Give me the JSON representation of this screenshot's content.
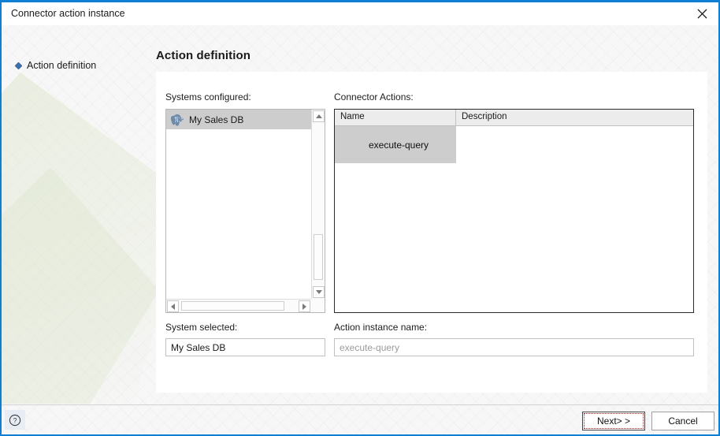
{
  "window": {
    "title": "Connector action instance",
    "close_icon": "close-icon",
    "accent_color": "#0f7fd4"
  },
  "nav": {
    "items": [
      {
        "label": "Action definition",
        "bullet": "diamond-bullet-icon",
        "selected": true
      }
    ]
  },
  "page": {
    "title": "Action definition"
  },
  "systems": {
    "label": "Systems configured:",
    "items": [
      {
        "name": "My Sales DB",
        "icon": "postgresql-icon",
        "selected": true
      }
    ],
    "scrollbars": {
      "vertical_up": "scroll-up-icon",
      "vertical_down": "scroll-down-icon",
      "horizontal_left": "scroll-left-icon",
      "horizontal_right": "scroll-right-icon"
    }
  },
  "actions_table": {
    "label": "Connector Actions:",
    "columns": [
      "Name",
      "Description"
    ],
    "rows": [
      {
        "name": "execute-query",
        "description": "",
        "selected": true
      }
    ]
  },
  "system_selected": {
    "label": "System selected:",
    "value": "My Sales DB",
    "placeholder": ""
  },
  "action_instance_name": {
    "label": "Action instance name:",
    "value": "",
    "placeholder": "execute-query"
  },
  "footer": {
    "help_icon": "help-icon",
    "help_label": "?",
    "next_label": "Next> >",
    "cancel_label": "Cancel"
  }
}
